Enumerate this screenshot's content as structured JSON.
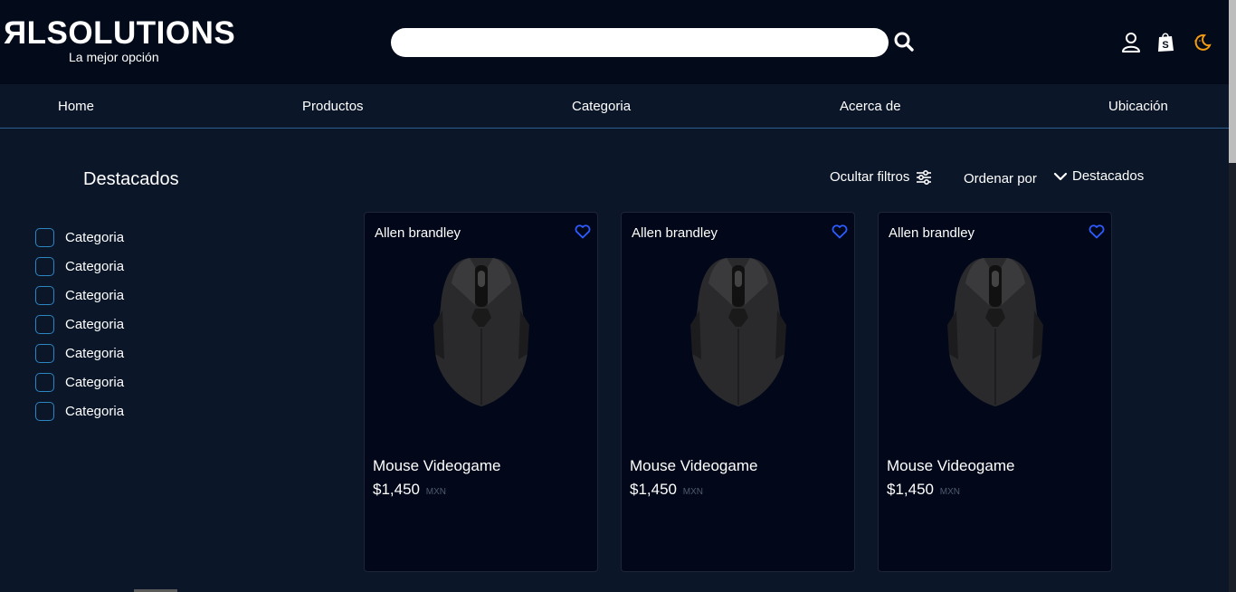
{
  "header": {
    "logo_title": "ЯLSOLUTIONS",
    "logo_subtitle": "La mejor opción",
    "search_placeholder": ""
  },
  "nav": {
    "items": [
      {
        "label": "Home"
      },
      {
        "label": "Productos"
      },
      {
        "label": "Categoria"
      },
      {
        "label": "Acerca de"
      },
      {
        "label": "Ubicación"
      }
    ]
  },
  "sidebar": {
    "title": "Destacados",
    "categories": [
      {
        "label": "Categoria"
      },
      {
        "label": "Categoria"
      },
      {
        "label": "Categoria"
      },
      {
        "label": "Categoria"
      },
      {
        "label": "Categoria"
      },
      {
        "label": "Categoria"
      },
      {
        "label": "Categoria"
      }
    ]
  },
  "toolbar": {
    "hide_filters": "Ocultar filtros",
    "sort_label": "Ordenar por",
    "sort_value": "Destacados"
  },
  "products": [
    {
      "brand": "Allen brandley",
      "name": "Mouse Videogame",
      "price": "$1,450",
      "currency": "MXN"
    },
    {
      "brand": "Allen brandley",
      "name": "Mouse Videogame",
      "price": "$1,450",
      "currency": "MXN"
    },
    {
      "brand": "Allen brandley",
      "name": "Mouse Videogame",
      "price": "$1,450",
      "currency": "MXN"
    }
  ],
  "icons": {
    "search": "search-icon",
    "user": "user-icon",
    "cart": "shopping-bag-icon",
    "theme": "moon-icon",
    "filters": "sliders-icon",
    "sort": "chevron-down-icon",
    "favorite": "heart-icon"
  },
  "colors": {
    "header_bg": "#030a19",
    "page_bg": "#0b1628",
    "card_bg": "#02081a",
    "accent_blue": "#2d5bff",
    "checkbox_border": "#2e86c1",
    "theme_icon": "#f39c12"
  }
}
